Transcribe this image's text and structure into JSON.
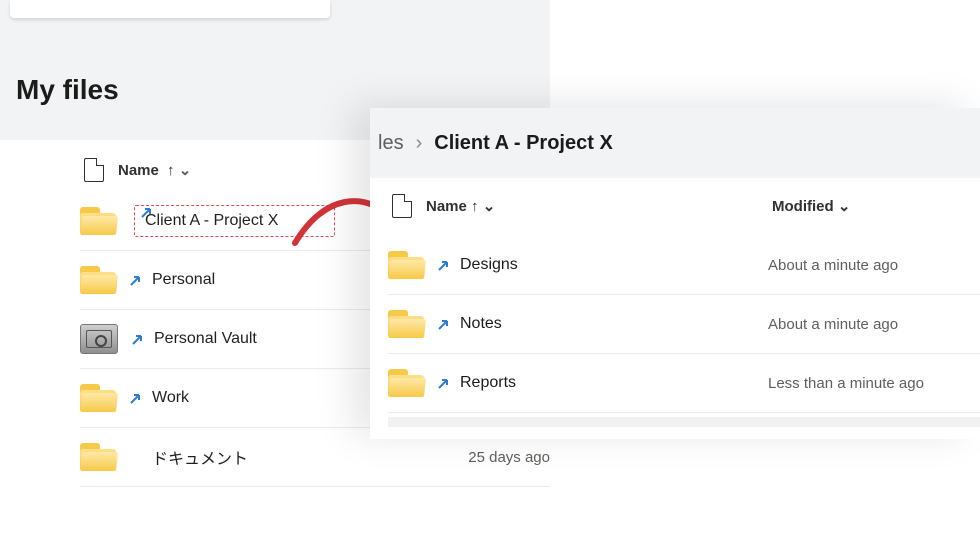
{
  "panelA": {
    "title": "My files",
    "columns": {
      "name": "Name",
      "sort_arrow": "↑",
      "chev": "⌄"
    },
    "rows": [
      {
        "icon": "folder",
        "shortcut": true,
        "name": "Client A - Project X",
        "highlighted": true
      },
      {
        "icon": "folder",
        "shortcut": true,
        "name": "Personal"
      },
      {
        "icon": "vault",
        "shortcut": true,
        "name": "Personal Vault"
      },
      {
        "icon": "folder",
        "shortcut": true,
        "name": "Work"
      },
      {
        "icon": "folder",
        "shortcut": false,
        "name": "ドキュメント",
        "modified": "25 days ago"
      }
    ]
  },
  "panelB": {
    "breadcrumb": {
      "prev_fragment": "les",
      "sep": "›",
      "current": "Client A - Project X"
    },
    "columns": {
      "name": "Name",
      "sort_arrow": "↑",
      "chev": "⌄",
      "modified": "Modified"
    },
    "rows": [
      {
        "icon": "folder",
        "shortcut": true,
        "name": "Designs",
        "modified": "About a minute ago"
      },
      {
        "icon": "folder",
        "shortcut": true,
        "name": "Notes",
        "modified": "About a minute ago"
      },
      {
        "icon": "folder",
        "shortcut": true,
        "name": "Reports",
        "modified": "Less than a minute ago"
      }
    ]
  }
}
